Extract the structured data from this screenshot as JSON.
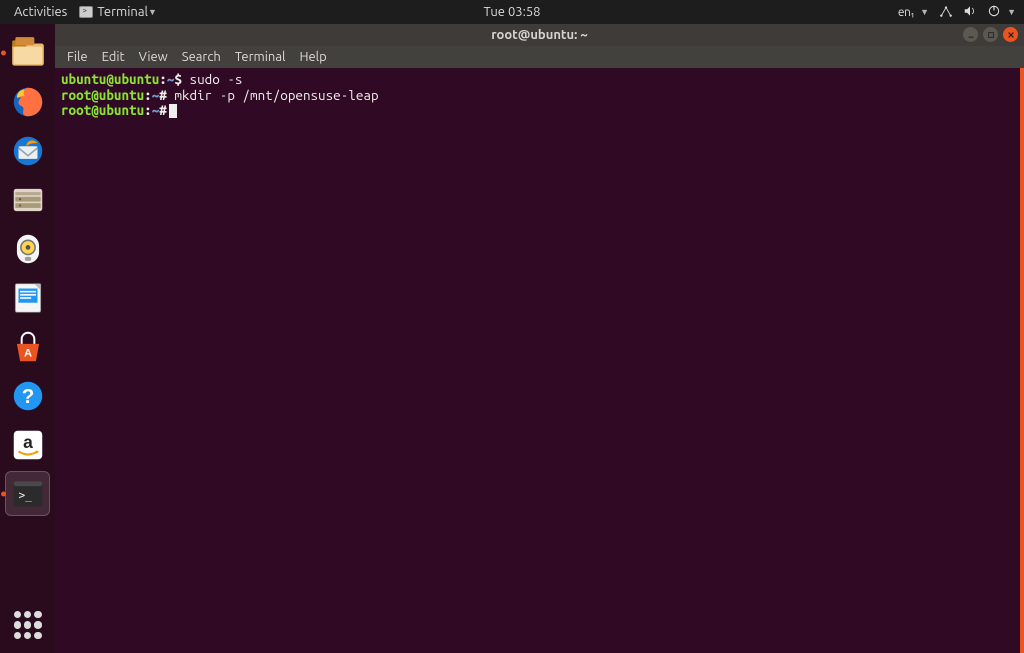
{
  "topbar": {
    "activities": "Activities",
    "appmenu_label": "Terminal",
    "clock": "Tue 03:58",
    "lang": "en₁"
  },
  "window": {
    "title": "root@ubuntu: ~"
  },
  "menubar": {
    "items": [
      "File",
      "Edit",
      "View",
      "Search",
      "Terminal",
      "Help"
    ]
  },
  "dock": {
    "items": [
      {
        "name": "files-icon"
      },
      {
        "name": "firefox-icon"
      },
      {
        "name": "thunderbird-icon"
      },
      {
        "name": "nautilus-icon"
      },
      {
        "name": "rhythmbox-icon"
      },
      {
        "name": "libreoffice-writer-icon"
      },
      {
        "name": "ubuntu-software-icon"
      },
      {
        "name": "help-icon"
      },
      {
        "name": "amazon-icon"
      },
      {
        "name": "terminal-icon"
      }
    ]
  },
  "terminal": {
    "lines": [
      {
        "user": "ubuntu@ubuntu",
        "path": "~",
        "sym": "$",
        "cmd": " sudo -s"
      },
      {
        "user": "root@ubuntu",
        "path": "~",
        "sym": "#",
        "cmd": " mkdir -p /mnt/opensuse-leap"
      },
      {
        "user": "root@ubuntu",
        "path": "~",
        "sym": "#",
        "cmd": ""
      }
    ]
  }
}
